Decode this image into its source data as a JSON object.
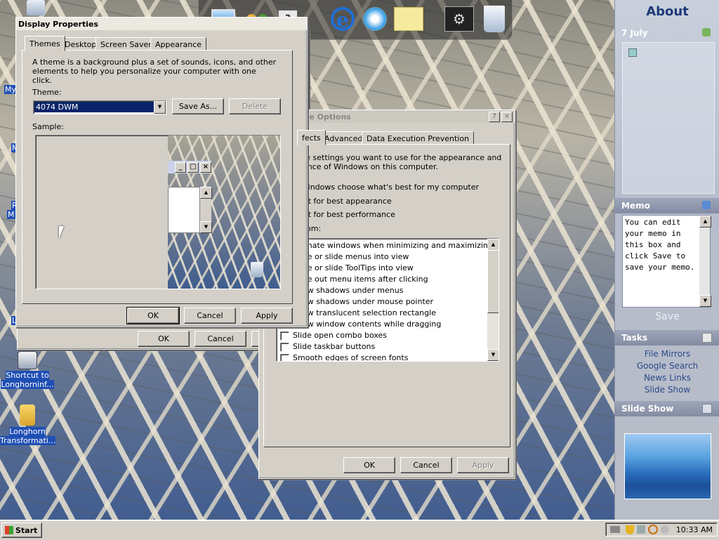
{
  "desktop": {
    "icons": [
      {
        "name": "shortcut-longhorninfo-icon",
        "label_line1": "Shortcut to",
        "label_line2": "Longhorninf..."
      },
      {
        "name": "longhorn-transformation-folder-icon",
        "label_line1": "Longhorn",
        "label_line2": "Transformati..."
      }
    ],
    "edge_labels": [
      "My",
      "M",
      "Re",
      "M",
      "L"
    ]
  },
  "dock": {
    "items": [
      "my-computer-icon",
      "users-icon",
      "help-icon",
      "internet-explorer-icon",
      "media-player-icon",
      "notes-icon",
      "settings-icon",
      "recycle-bin-icon"
    ]
  },
  "display_properties": {
    "title": "Display Properties",
    "tabs": [
      "Themes",
      "Desktop",
      "Screen Saver",
      "Appearance"
    ],
    "description": "A theme is a background plus a set of sounds, icons, and other elements to help you personalize your computer with one click.",
    "theme_label": "Theme:",
    "theme_value": "4074 DWM",
    "save_as": "Save As...",
    "delete": "Delete",
    "sample_label": "Sample:",
    "ok": "OK",
    "cancel": "Cancel",
    "apply": "Apply"
  },
  "behind_dialog": {
    "ok": "OK",
    "cancel": "Cancel"
  },
  "performance_options": {
    "title": "nce Options",
    "help_btn": "?",
    "close_btn": "×",
    "tabs": [
      "fects",
      "Advanced",
      "Data Execution Prevention"
    ],
    "intro_line1": "the settings you want to use for the appearance and",
    "intro_line2": "nance of Windows on this computer.",
    "radio1": "Windows choose what's best for my computer",
    "radio2": "ust for best appearance",
    "radio3": "ust for best performance",
    "radio4": "stom:",
    "options": [
      "nimate windows when minimizing and maximizing",
      "ade or slide menus into view",
      "ade or slide ToolTips into view",
      "ade out menu items after clicking",
      "how shadows under menus",
      "how shadows under mouse pointer",
      "how translucent selection rectangle",
      "how window contents while dragging",
      "Slide open combo boxes",
      "Slide taskbar buttons",
      "Smooth edges of screen fonts"
    ],
    "ok": "OK",
    "cancel": "Cancel",
    "apply": "Apply"
  },
  "sidebar": {
    "about": "About",
    "date": "7 July",
    "memo_title": "Memo",
    "memo_text": "You can edit your memo in this box and click Save to save your memo.",
    "save": "Save",
    "tasks_title": "Tasks",
    "tasks": [
      "File Mirrors",
      "Google Search",
      "News Links",
      "Slide Show"
    ],
    "slideshow_title": "Slide Show"
  },
  "taskbar": {
    "start": "Start",
    "clock": "10:33 AM"
  }
}
